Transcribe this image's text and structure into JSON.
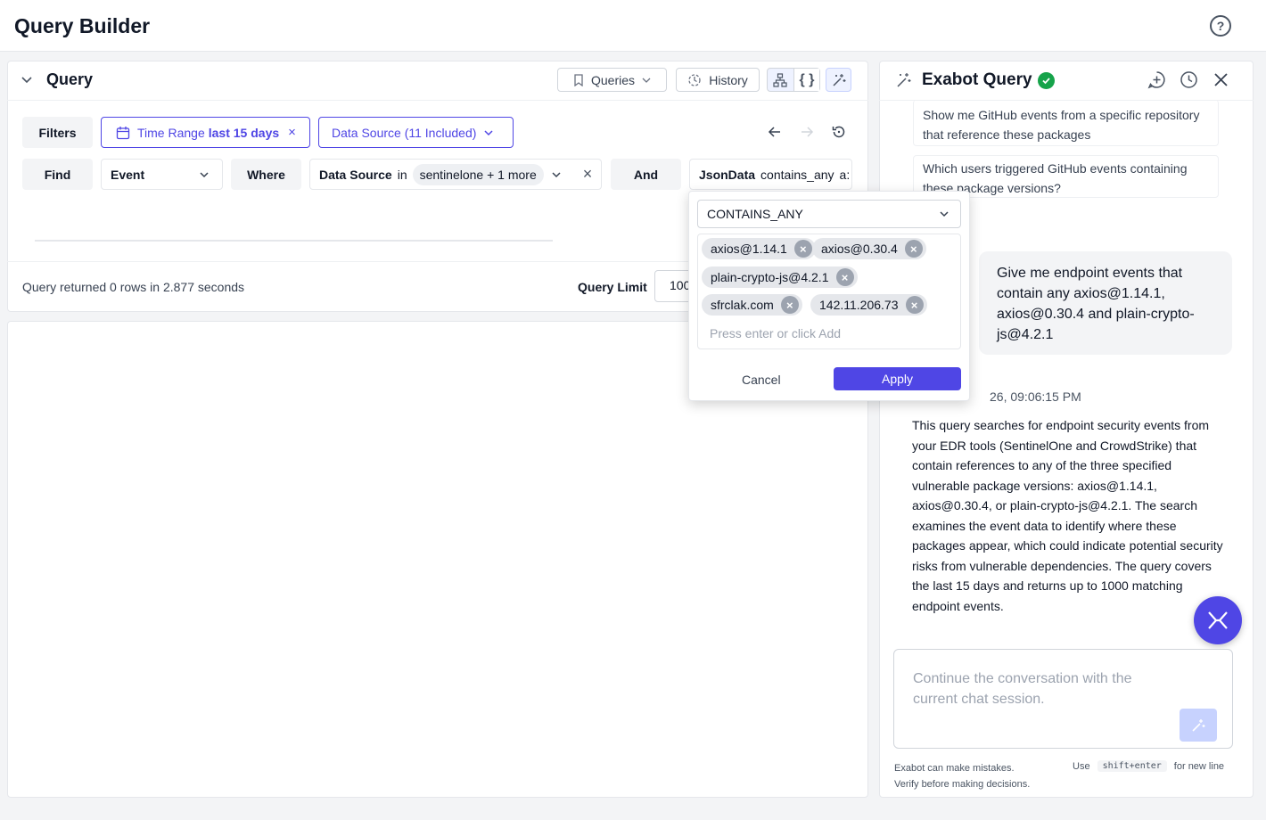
{
  "app": {
    "title": "Query Builder"
  },
  "query": {
    "title": "Query",
    "toolbar": {
      "queries_label": "Queries",
      "history_label": "History"
    },
    "filters_label": "Filters",
    "time_range": {
      "prefix": "Time Range",
      "value": "last 15 days"
    },
    "data_source_label": "Data Source (11 Included)",
    "find_label": "Find",
    "entity": "Event",
    "where_label": "Where",
    "condition1": {
      "field": "Data Source",
      "operator": "in",
      "value": "sentinelone + 1 more"
    },
    "and_label": "And",
    "condition2": {
      "field": "JsonData",
      "operator": "contains_any",
      "value_truncated": "a:"
    },
    "status": "Query returned 0 rows in 2.877 seconds",
    "limit_label": "Query Limit",
    "limit_value": "100"
  },
  "popover": {
    "operator": "CONTAINS_ANY",
    "tags": [
      "axios@1.14.1",
      "axios@0.30.4",
      "plain-crypto-js@4.2.1",
      "sfrclak.com",
      "142.11.206.73"
    ],
    "input_placeholder": "Press enter or click Add",
    "cancel_label": "Cancel",
    "apply_label": "Apply"
  },
  "exabot": {
    "title": "Exabot Query",
    "suggestions": [
      "Show me GitHub events from a specific repository that reference these packages",
      "Which users triggered GitHub events containing these package versions?"
    ],
    "user_message": "Give me endpoint events that contain any axios@1.14.1, axios@0.30.4 and plain-crypto-js@4.2.1",
    "timestamp": "26, 09:06:15 PM",
    "bot_message": "This query searches for endpoint security events from your EDR tools (SentinelOne and CrowdStrike) that contain references to any of the three specified vulnerable package versions: axios@1.14.1, axios@0.30.4, or plain-crypto-js@4.2.1. The search examines the event data to identify where these packages appear, which could indicate potential security risks from vulnerable dependencies. The query covers the last 15 days and returns up to 1000 matching endpoint events.",
    "input_placeholder": "Continue the conversation with the current chat session.",
    "disclaimer_line1": "Exabot can make mistakes.",
    "disclaimer_line2": "Verify before making decisions.",
    "hint_use": "Use",
    "hint_key": "shift+enter",
    "hint_suffix": "for new line"
  },
  "colors": {
    "accent": "#4f46e5",
    "success": "#16a34a"
  }
}
